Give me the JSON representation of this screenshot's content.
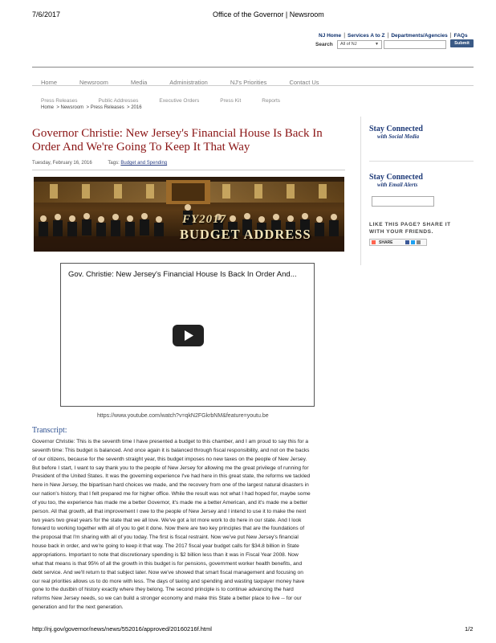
{
  "print_header": {
    "date": "7/6/2017",
    "title": "Office of the Governor | Newsroom"
  },
  "utility_nav": [
    "NJ Home",
    "Services A to Z",
    "Departments/Agencies",
    "FAQs"
  ],
  "search": {
    "label": "Search",
    "scope": "All of NJ",
    "submit": "Submit"
  },
  "main_nav": [
    "Home",
    "Newsroom",
    "Media",
    "Administration",
    "NJ's Priorities",
    "Contact Us"
  ],
  "sub_nav": [
    "Press Releases",
    "Public Addresses",
    "Executive Orders",
    "Press Kit",
    "Reports"
  ],
  "breadcrumb": "Home  > Newsroom  > Press Releases  > 2016",
  "article": {
    "title_line1": "Governor Christie: New Jersey's Financial House Is Back In",
    "title_line2": "Order And We're Going To Keep It That Way",
    "date": "Tuesday, February 16, 2016",
    "tags_label": "Tags:",
    "tag": "Budget and Spending",
    "banner_line1": "FY2017",
    "banner_line2": "BUDGET ADDRESS",
    "video_title": "Gov. Christie: New Jersey's Financial House Is Back In Order And...",
    "video_url": "https://www.youtube.com/watch?v=qkN2FGkrbNM&feature=youtu.be",
    "transcript_heading": "Transcript:",
    "transcript_lines": [
      "Governor Christie:  This is the seventh time I have presented a budget to this chamber, and I am proud to say this for a",
      "seventh time: This budget is balanced. And once again it is balanced through fiscal responsibility, and not on the backs",
      "of our citizens, because for the seventh straight year, this budget imposes no new taxes on the people of New Jersey.",
      "But before I start, I want to say thank you to the people of New Jersey for allowing me the great privilege of running for",
      "President of the United States. It was the governing experience I've had here in this great state, the reforms we tackled",
      "here in New Jersey, the bipartisan hard choices we made, and the recovery from one of the largest natural disasters in",
      "our nation's history, that I felt prepared me for higher office. While the result was not what I had hoped for, maybe some",
      "of you too, the experience has made me a better Governor, it's made me a better American, and it's made me a better",
      "person. All that growth, all that improvement I owe to the people of New Jersey and I intend to use it to make the next",
      "two years two great years for the state that we all love. We've got a lot more work to do here in our state. And I look",
      "forward to working together with all of you to get it done. Now there are two key principles that are the foundations of",
      "the proposal that I'm sharing with all of you today. The first is fiscal restraint. Now we've put New Jersey's financial",
      "house back in order, and we're going to keep it that way. The 2017 fiscal year budget calls for $34.8 billion in State",
      "appropriations. Important to note that discretionary spending is $2 billion less than it was in Fiscal Year 2008. Now",
      "what that means is that 95% of all the growth in this budget is for pensions, government worker health benefits, and",
      "debt service. And we'll return to that subject later. Now we've showed that smart fiscal management and focusing on",
      "our real priorities allows us to do more with less. The days of taxing and spending and wasting taxpayer money have",
      "gone to the dustbin of history exactly where they belong. The second principle is to continue advancing the hard",
      "reforms New Jersey needs, so we can build a stronger economy and make this State a better place to live -- for our",
      "generation and for the next generation."
    ]
  },
  "sidebar": {
    "social_heading": "Stay Connected",
    "social_sub": "with Social Media",
    "email_heading": "Stay Connected",
    "email_sub": "with Email Alerts",
    "share_line1": "LIKE THIS PAGE? SHARE IT",
    "share_line2": "WITH YOUR FRIENDS.",
    "share_button": "SHARE"
  },
  "footer": {
    "url": "http://nj.gov/governor/news/news/552016/approved/20160216f.html",
    "page": "1/2"
  },
  "colors": {
    "title": "#8a1414",
    "sidebar_heading": "#1e3a78",
    "submit": "#3a5a86"
  }
}
